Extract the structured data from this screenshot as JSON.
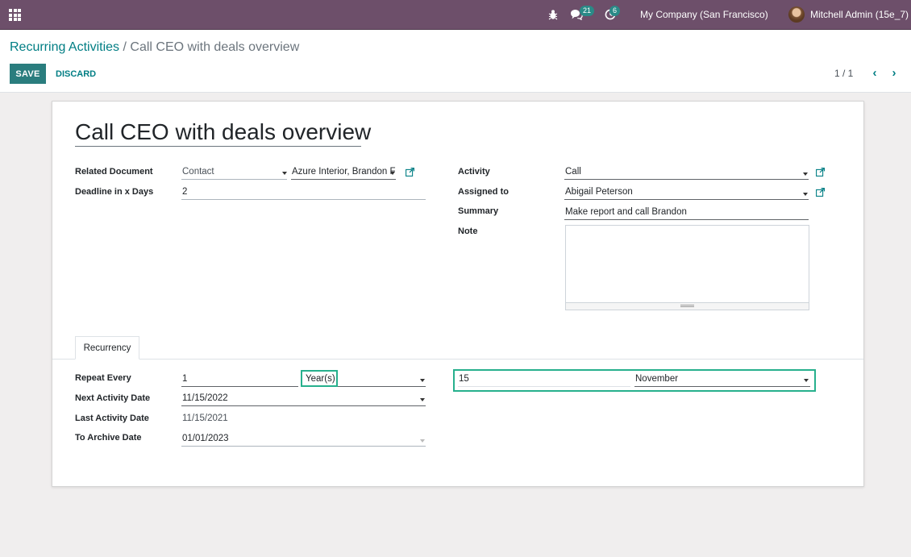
{
  "navbar": {
    "company": "My Company (San Francisco)",
    "user": "Mitchell Admin (15e_7)",
    "messages_count": "21",
    "activities_count": "6"
  },
  "breadcrumb": {
    "parent": "Recurring Activities",
    "separator": " / ",
    "current": "Call CEO with deals overview"
  },
  "buttons": {
    "save": "SAVE",
    "discard": "DISCARD"
  },
  "pager": {
    "value": "1 / 1"
  },
  "form": {
    "title": "Call CEO with deals overview",
    "related_document": {
      "label": "Related Document",
      "model": "Contact",
      "record": "Azure Interior, Brandon F"
    },
    "deadline": {
      "label": "Deadline in x Days",
      "value": "2"
    },
    "activity": {
      "label": "Activity",
      "value": "Call"
    },
    "assigned_to": {
      "label": "Assigned to",
      "value": "Abigail Peterson"
    },
    "summary": {
      "label": "Summary",
      "value": "Make report and call Brandon"
    },
    "note": {
      "label": "Note",
      "value": ""
    }
  },
  "recurrency": {
    "tab_label": "Recurrency",
    "repeat_every": {
      "label": "Repeat Every",
      "interval": "1",
      "unit": "Year(s)",
      "day": "15",
      "month": "November"
    },
    "next_activity_date": {
      "label": "Next Activity Date",
      "value": "11/15/2022"
    },
    "last_activity_date": {
      "label": "Last Activity Date",
      "value": "11/15/2021"
    },
    "to_archive_date": {
      "label": "To Archive Date",
      "value": "01/01/2023"
    }
  },
  "colors": {
    "navbar": "#6d4f6a",
    "primary_button": "#2a7d7e",
    "link": "#017e84",
    "badge": "#2a8a87",
    "highlight": "#27b08d"
  }
}
